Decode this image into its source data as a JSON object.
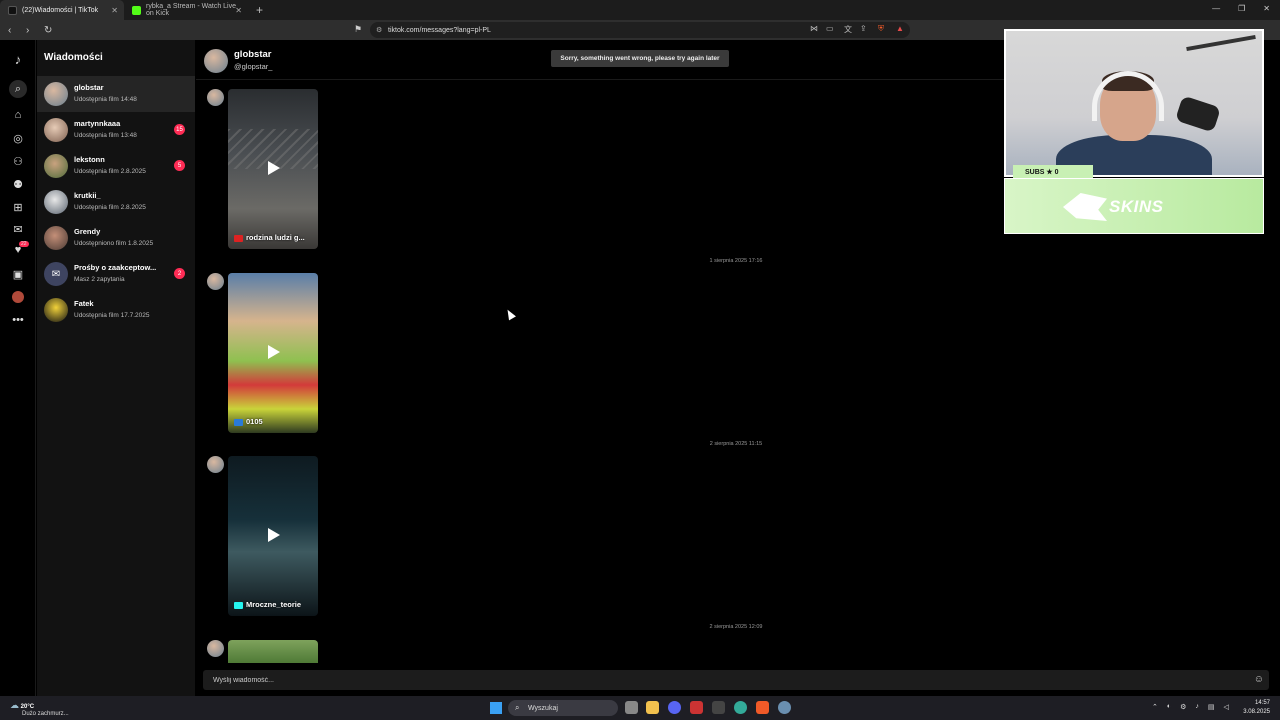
{
  "browser": {
    "tabs": [
      {
        "label": "(22)Wiadomości | TikTok",
        "active": true
      },
      {
        "label": "rybka_a Stream - Watch Live on Kick",
        "active": false
      }
    ],
    "url": "tiktok.com/messages?lang=pl-PL"
  },
  "rail": {
    "notification_badge": "22"
  },
  "conversations": {
    "title": "Wiadomości",
    "items": [
      {
        "name": "globstar",
        "sub": "Udostępnia film 14:48",
        "badge": "",
        "active": true
      },
      {
        "name": "martynnkaaa",
        "sub": "Udostępnia film 13:48",
        "badge": "15",
        "active": false
      },
      {
        "name": "lekstonn",
        "sub": "Udostępnia film 2.8.2025",
        "badge": "5",
        "active": false
      },
      {
        "name": "krutkii_",
        "sub": "Udostępnia film 2.8.2025",
        "badge": "",
        "active": false
      },
      {
        "name": "Grendy",
        "sub": "Udostępniono film 1.8.2025",
        "badge": "",
        "active": false
      },
      {
        "name": "Prośby o zaakceptow...",
        "sub": "Masz 2 zapytania",
        "badge": "2",
        "active": false
      },
      {
        "name": "Fatek",
        "sub": "Udostępnia film 17.7.2025",
        "badge": "",
        "active": false
      }
    ]
  },
  "chat": {
    "name": "globstar",
    "handle": "@glopstar_",
    "toast": "Sorry, something went wrong, please try again later",
    "videos": [
      {
        "caption": "rodzina ludzi g..."
      },
      {
        "caption": "0105"
      },
      {
        "caption": "Mroczne_teorie"
      }
    ],
    "timestamps": [
      "1 sierpnia 2025 17:16",
      "2 sierpnia 2025 11:15",
      "2 sierpnia 2025 12:09"
    ],
    "input_placeholder": "Wyślij wiadomość..."
  },
  "stream_overlay": {
    "subs": "SUBS ★ 0",
    "sponsor": "SKINS"
  },
  "taskbar": {
    "weather_temp": "20°C",
    "weather_desc": "Dużo zachmurz...",
    "search": "Wyszukaj",
    "time": "14:57",
    "date": "3.08.2025"
  }
}
